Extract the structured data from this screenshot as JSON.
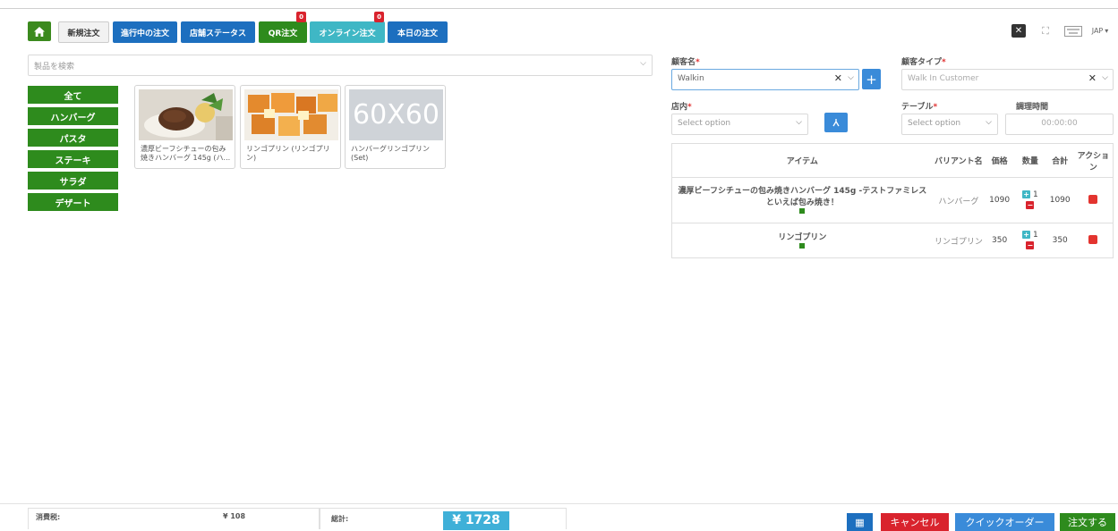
{
  "tabs": [
    {
      "label": "新規注文",
      "badge": null
    },
    {
      "label": "進行中の注文",
      "badge": null
    },
    {
      "label": "店舗ステータス",
      "badge": null
    },
    {
      "label": "QR注文",
      "badge": "0"
    },
    {
      "label": "オンライン注文",
      "badge": "0"
    },
    {
      "label": "本日の注文",
      "badge": null
    }
  ],
  "language": "JAP",
  "search": {
    "placeholder": "製品を検索"
  },
  "categories": [
    "全て",
    "ハンバーグ",
    "パスタ",
    "ステーキ",
    "サラダ",
    "デザート"
  ],
  "products": [
    {
      "name": "濃厚ビーフシチューの包み焼きハンバーグ 145g (ハ..."
    },
    {
      "name": "リンゴプリン (リンゴプリン)"
    },
    {
      "name": "ハンバーグリンゴプリン (Set)",
      "image_text": "60X60"
    }
  ],
  "customer": {
    "name_label": "顧客名",
    "name_value": "Walkin",
    "type_label": "顧客タイプ",
    "type_value": "Walk In Customer"
  },
  "store": {
    "label": "店内",
    "placeholder": "Select option"
  },
  "table": {
    "label": "テーブル",
    "placeholder": "Select option"
  },
  "cook_time": {
    "label": "調理時間",
    "value": "00:00:00"
  },
  "order_table": {
    "headers": [
      "アイテム",
      "バリアント名",
      "価格",
      "数量",
      "合計",
      "アクション"
    ],
    "rows": [
      {
        "item": "濃厚ビーフシチューの包み焼きハンバーグ 145g -テストファミレスといえば包み焼き！",
        "variant": "ハンバーグ",
        "price": "1090",
        "qty": "1",
        "total": "1090"
      },
      {
        "item": "リンゴプリン",
        "variant": "リンゴプリン",
        "price": "350",
        "qty": "1",
        "total": "350"
      }
    ]
  },
  "summary": {
    "tax_label": "消費税:",
    "tax_value": "¥ 108",
    "total_label": "総計:",
    "total_value": "¥ 1728"
  },
  "buttons": {
    "cancel": "キャンセル",
    "quick_order": "クイックオーダー",
    "order": "注文する"
  },
  "colors": {
    "green": "#2e8b1d",
    "blue": "#1d6fbf",
    "teal": "#3fb7c5",
    "red": "#d9232d"
  }
}
